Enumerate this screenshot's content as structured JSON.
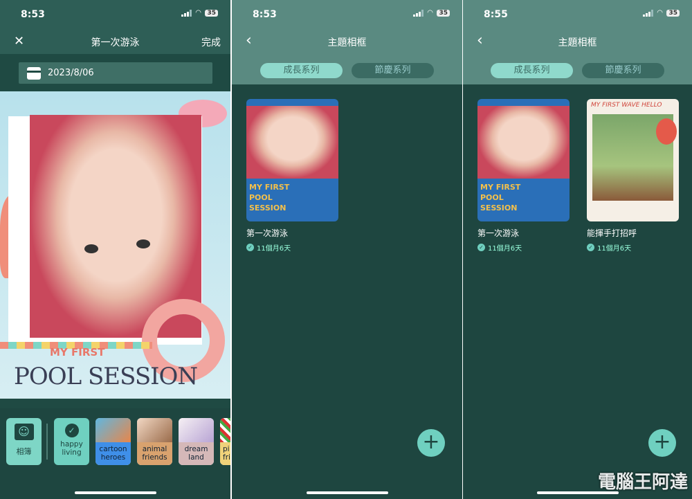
{
  "screen1": {
    "time": "8:53",
    "battery": "35",
    "nav": {
      "close": "✕",
      "title": "第一次游泳",
      "done": "完成"
    },
    "date": "2023/8/06",
    "frame_text": {
      "line1": "MY FIRST",
      "line2": "POOL SESSION"
    },
    "themes": [
      {
        "label": "相簿",
        "color": "#7ed6c6"
      },
      {
        "label": "happy living",
        "color": "#6fd0c0",
        "selected": true
      },
      {
        "label": "cartoon heroes",
        "color": "#3f8fe8"
      },
      {
        "label": "animal friends",
        "color": "#d9a26e"
      },
      {
        "label": "dream land",
        "color": "#d5b8b8"
      },
      {
        "label": "pi fri",
        "color": "#f0d27a"
      }
    ]
  },
  "screen2": {
    "time": "8:53",
    "battery": "35",
    "nav": {
      "back": "‹",
      "title": "主題相框"
    },
    "tabs": [
      "成長系列",
      "節慶系列"
    ],
    "cards": [
      {
        "name": "第一次游泳",
        "age": "11個月6天",
        "art": "MY FIRST POOL SESSION"
      }
    ],
    "fab": "+"
  },
  "screen3": {
    "time": "8:55",
    "battery": "35",
    "nav": {
      "back": "‹",
      "title": "主題相框"
    },
    "tabs": [
      "成長系列",
      "節慶系列"
    ],
    "cards": [
      {
        "name": "第一次游泳",
        "age": "11個月6天",
        "art": "MY FIRST POOL SESSION"
      },
      {
        "name": "能揮手打招呼",
        "age": "11個月6天",
        "art": "MY FIRST WAVE HELLO"
      }
    ],
    "fab": "+"
  },
  "watermark": {
    "text": "電腦王阿達",
    "url": "http://www.kocpc.com.tw"
  },
  "colors": {
    "header": "#5a8a81",
    "panel": "#1e4640",
    "accent": "#6fd0c0"
  }
}
